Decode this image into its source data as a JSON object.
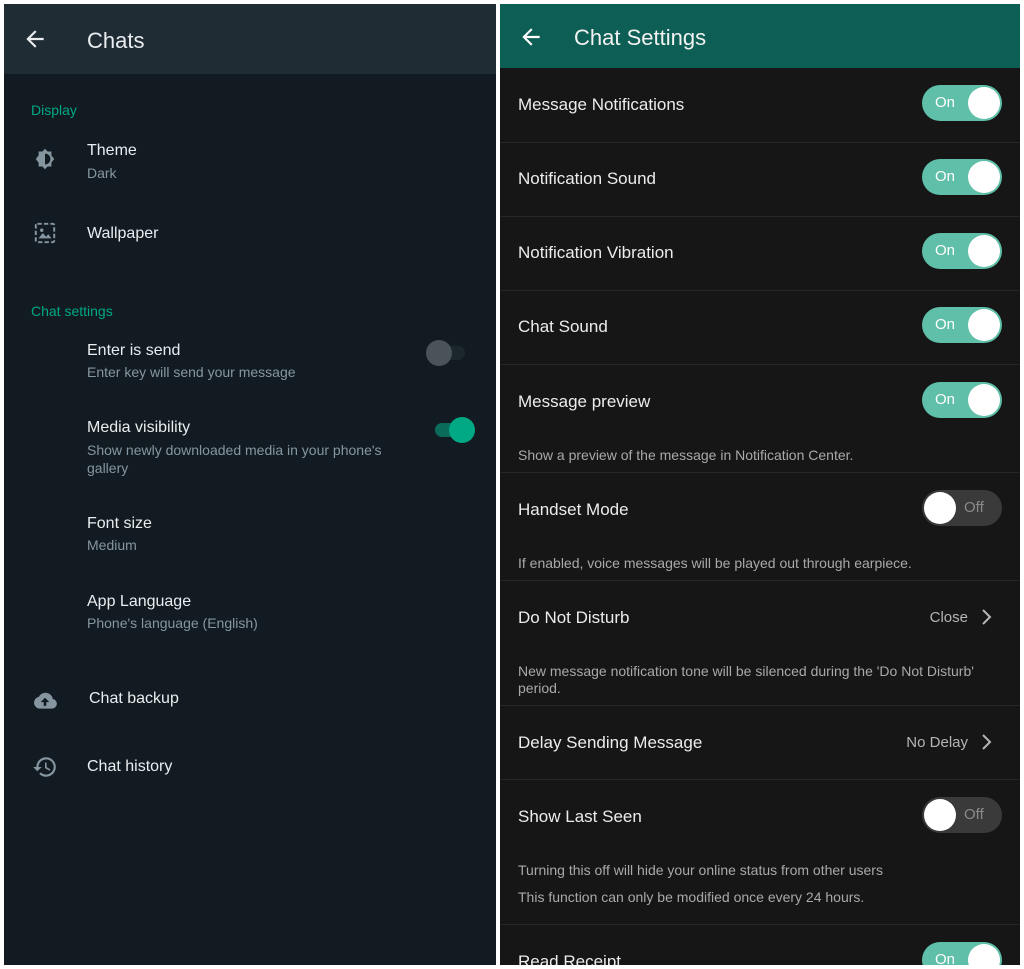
{
  "left_panel": {
    "title": "Chats",
    "display_section": "Display",
    "theme": {
      "title": "Theme",
      "value": "Dark"
    },
    "wallpaper": {
      "title": "Wallpaper"
    },
    "chat_settings_section": "Chat settings",
    "enter_is_send": {
      "title": "Enter is send",
      "subtitle": "Enter key will send your message",
      "enabled": false
    },
    "media_visibility": {
      "title": "Media visibility",
      "subtitle_line1": "Show newly downloaded media in your phone's",
      "subtitle_line2": "gallery",
      "enabled": true
    },
    "font_size": {
      "title": "Font size",
      "value": "Medium"
    },
    "app_language": {
      "title": "App Language",
      "value": "Phone's language (English)"
    },
    "chat_backup": {
      "title": "Chat backup"
    },
    "chat_history": {
      "title": "Chat history"
    },
    "colors": {
      "accent": "#00a884",
      "background": "#121b22",
      "appbar": "#1f2c34"
    }
  },
  "right_panel": {
    "title": "Chat Settings",
    "message_notifications": {
      "title": "Message Notifications",
      "state": "On"
    },
    "notification_sound": {
      "title": "Notification Sound",
      "state": "On"
    },
    "notification_vibration": {
      "title": "Notification Vibration",
      "state": "On"
    },
    "chat_sound": {
      "title": "Chat Sound",
      "state": "On"
    },
    "message_preview": {
      "title": "Message preview",
      "state": "On",
      "description": "Show a preview of the message in Notification Center."
    },
    "handset_mode": {
      "title": "Handset Mode",
      "state": "Off",
      "description": "If enabled, voice messages will be played out through earpiece."
    },
    "do_not_disturb": {
      "title": "Do Not Disturb",
      "value": "Close",
      "description_line1": "New message notification tone will be silenced during the 'Do Not Disturb'",
      "description_line2": "period."
    },
    "delay_sending": {
      "title": "Delay Sending Message",
      "value": "No Delay"
    },
    "show_last_seen": {
      "title": "Show Last Seen",
      "state": "Off",
      "description_line1": "Turning this off will hide your online status from other users",
      "description_line2": "This function can only be modified once every 24 hours."
    },
    "read_receipt": {
      "title": "Read Receipt",
      "state": "On"
    },
    "colors": {
      "appbar": "#0d5e54",
      "toggle_on": "#5fbfa8",
      "toggle_off": "#3a3a3a",
      "background": "#161616"
    }
  }
}
